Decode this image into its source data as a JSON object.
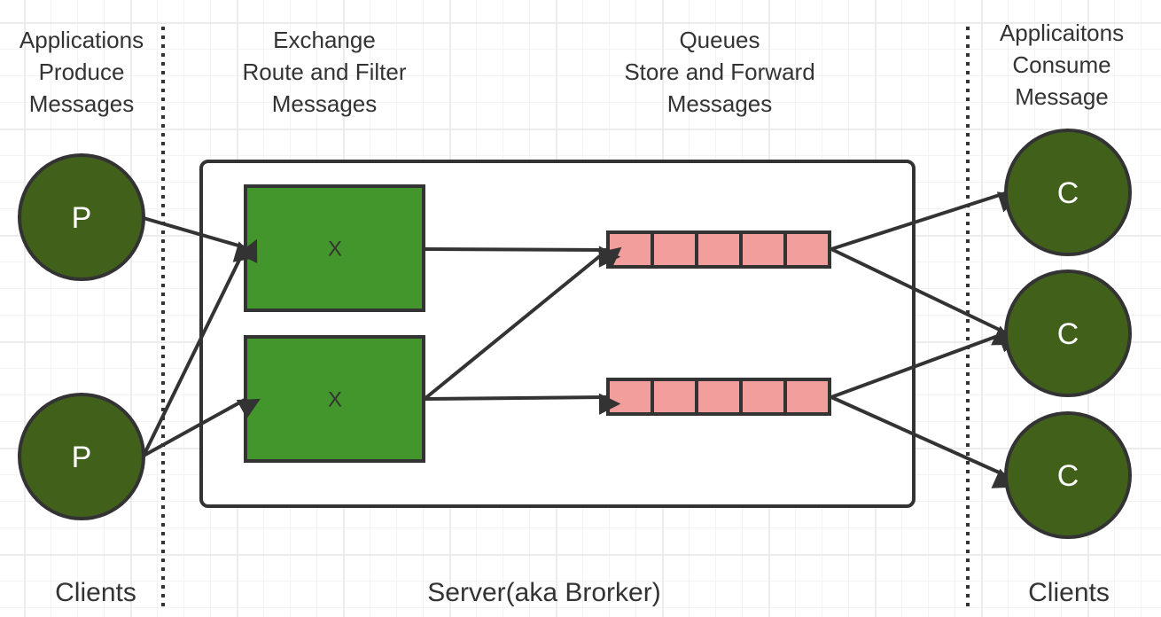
{
  "headers": {
    "producers": [
      "Applications",
      "Produce",
      "Messages"
    ],
    "exchange": [
      "Exchange",
      "Route and Filter",
      "Messages"
    ],
    "queues": [
      "Queues",
      "Store and Forward",
      "Messages"
    ],
    "consumers": [
      "Applicaitons",
      "Consume",
      "Message"
    ]
  },
  "footers": {
    "left_clients": "Clients",
    "server": "Server(aka Brorker)",
    "right_clients": "Clients"
  },
  "nodes": {
    "producers": [
      {
        "label": "P"
      },
      {
        "label": "P"
      }
    ],
    "exchanges": [
      {
        "label": "X"
      },
      {
        "label": "X"
      }
    ],
    "queues": [
      {
        "slots": 5
      },
      {
        "slots": 5
      }
    ],
    "consumers": [
      {
        "label": "C"
      },
      {
        "label": "C"
      },
      {
        "label": "C"
      }
    ]
  },
  "colors": {
    "node_fill": "#41611b",
    "exchange_fill": "#42962b",
    "queue_fill": "#f19e9c",
    "stroke": "#333333"
  }
}
